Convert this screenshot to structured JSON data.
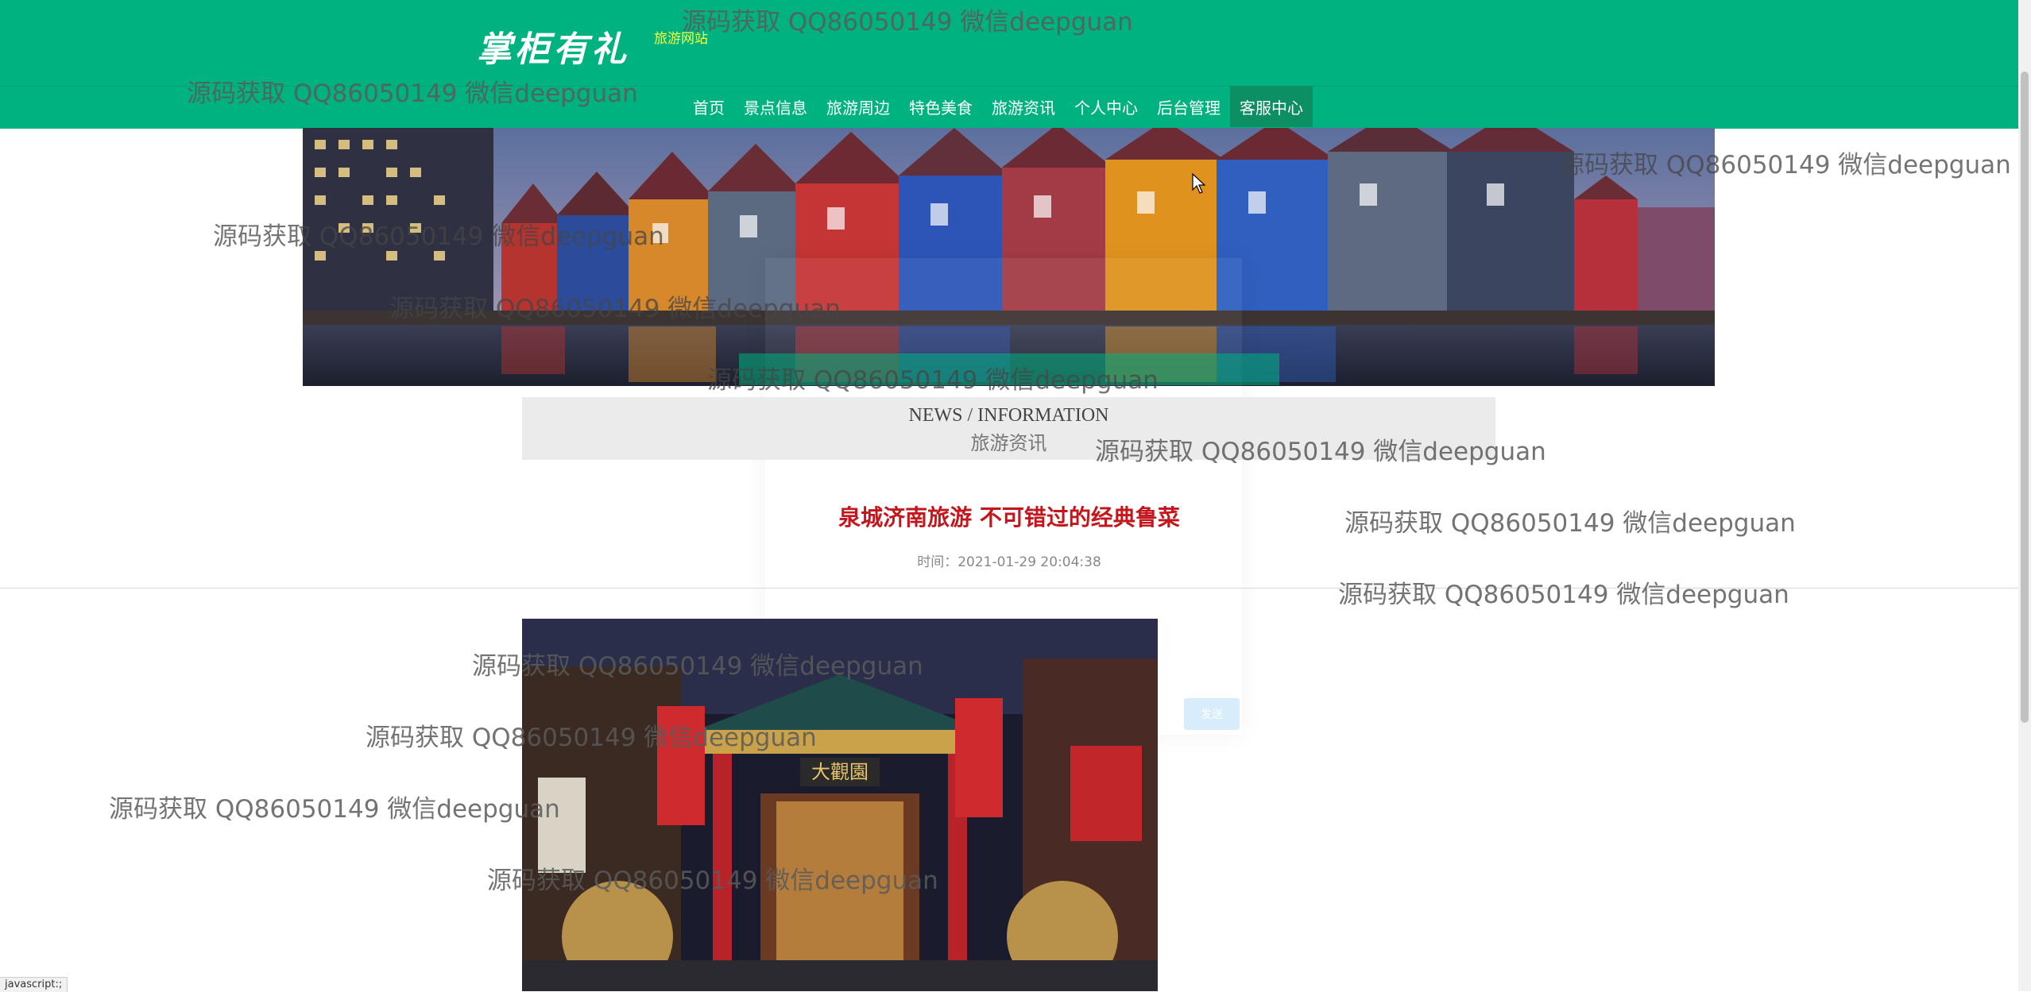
{
  "header": {
    "logo_text": "掌柜有礼",
    "logo_sub": "旅游网站",
    "nav": [
      {
        "label": "首页"
      },
      {
        "label": "景点信息"
      },
      {
        "label": "旅游周边"
      },
      {
        "label": "特色美食"
      },
      {
        "label": "旅游资讯"
      },
      {
        "label": "个人中心"
      },
      {
        "label": "后台管理"
      },
      {
        "label": "客服中心",
        "active": true
      }
    ]
  },
  "section": {
    "title_en": "NEWS / INFORMATION",
    "title_cn": "旅游资讯"
  },
  "article": {
    "title": "泉城济南旅游 不可错过的经典鲁菜",
    "time": "时间：2021-01-29 20:04:38",
    "photo_sign": "大觀園"
  },
  "modal": {
    "button_label": "发送"
  },
  "watermark": "源码获取 QQ86050149 微信deepguan",
  "statusbar": "javascript:;",
  "colors": {
    "brand_green": "#00b27f",
    "nav_active": "#0c8f63",
    "title_red": "#c4161c",
    "logo_sub_yellow": "#f7ff3b"
  }
}
